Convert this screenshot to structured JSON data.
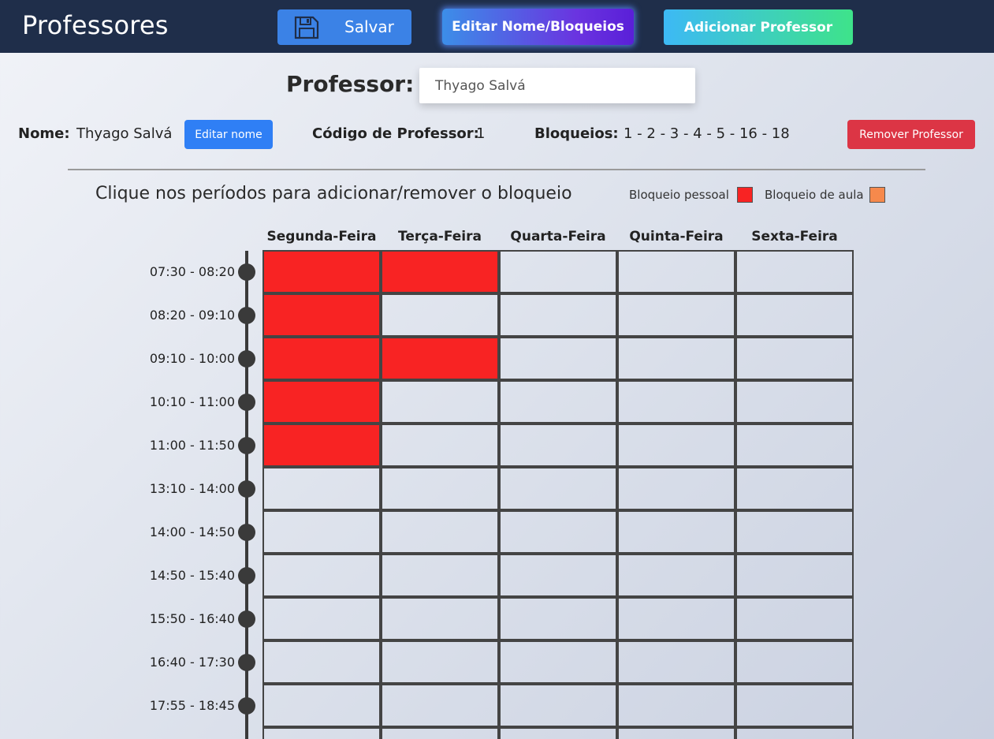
{
  "header": {
    "title": "Professores",
    "save_label": "Salvar",
    "edit_label": "Editar Nome/Bloqueios",
    "add_label": "Adicionar Professor"
  },
  "selector": {
    "label": "Professor:",
    "selected": "Thyago Salvá"
  },
  "info": {
    "name_label": "Nome:",
    "name_value": "Thyago Salvá",
    "edit_name_label": "Editar nome",
    "code_label": "Código de Professor:",
    "code_value": "1",
    "blocks_label": "Bloqueios:",
    "blocks_value": "1 - 2 - 3 - 4 - 5 - 16 - 18",
    "remove_label": "Remover Professor"
  },
  "instructions": "Clique nos períodos para adicionar/remover o bloqueio",
  "legend": {
    "personal_label": "Bloqueio pessoal",
    "personal_color": "#f82323",
    "class_label": "Bloqueio de aula",
    "class_color": "#f6894c"
  },
  "schedule": {
    "days": [
      "Segunda-Feira",
      "Terça-Feira",
      "Quarta-Feira",
      "Quinta-Feira",
      "Sexta-Feira"
    ],
    "times": [
      "07:30 - 08:20",
      "08:20 - 09:10",
      "09:10 - 10:00",
      "10:10 - 11:00",
      "11:00 - 11:50",
      "13:10 - 14:00",
      "14:00 - 14:50",
      "14:50 - 15:40",
      "15:50 - 16:40",
      "16:40 - 17:30",
      "17:55 - 18:45",
      ""
    ],
    "blocked": [
      [
        "personal",
        "personal",
        "",
        "",
        ""
      ],
      [
        "personal",
        "",
        "",
        "",
        ""
      ],
      [
        "personal",
        "personal",
        "",
        "",
        ""
      ],
      [
        "personal",
        "",
        "",
        "",
        ""
      ],
      [
        "personal",
        "",
        "",
        "",
        ""
      ],
      [
        "",
        "",
        "",
        "",
        ""
      ],
      [
        "",
        "",
        "",
        "",
        ""
      ],
      [
        "",
        "",
        "",
        "",
        ""
      ],
      [
        "",
        "",
        "",
        "",
        ""
      ],
      [
        "",
        "",
        "",
        "",
        ""
      ],
      [
        "",
        "",
        "",
        "",
        ""
      ],
      [
        "",
        "",
        "",
        "",
        ""
      ]
    ]
  }
}
